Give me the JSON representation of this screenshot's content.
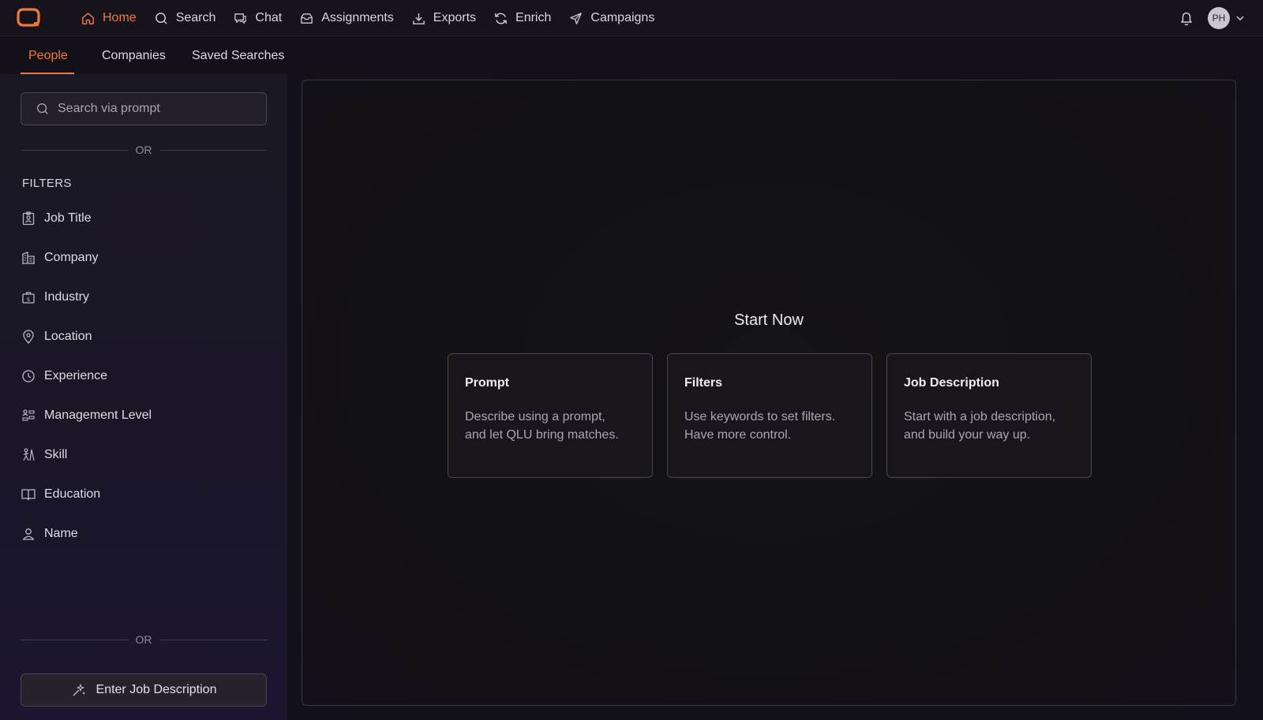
{
  "nav": {
    "items": [
      {
        "label": "Home",
        "icon": "home-icon",
        "active": true
      },
      {
        "label": "Search",
        "icon": "search-icon",
        "active": false
      },
      {
        "label": "Chat",
        "icon": "chat-icon",
        "active": false
      },
      {
        "label": "Assignments",
        "icon": "inbox-icon",
        "active": false
      },
      {
        "label": "Exports",
        "icon": "download-icon",
        "active": false
      },
      {
        "label": "Enrich",
        "icon": "refresh-icon",
        "active": false
      },
      {
        "label": "Campaigns",
        "icon": "send-icon",
        "active": false
      }
    ],
    "user_initials": "PH"
  },
  "subtabs": {
    "people": "People",
    "companies": "Companies",
    "saved_searches": "Saved Searches"
  },
  "sidebar": {
    "search_placeholder": "Search via prompt",
    "or_label": "OR",
    "filters_heading": "FILTERS",
    "filters": [
      {
        "label": "Job Title",
        "icon": "badge-icon"
      },
      {
        "label": "Company",
        "icon": "building-icon"
      },
      {
        "label": "Industry",
        "icon": "briefcase-dollar-icon"
      },
      {
        "label": "Location",
        "icon": "map-pin-icon"
      },
      {
        "label": "Experience",
        "icon": "clock-icon"
      },
      {
        "label": "Management Level",
        "icon": "hierarchy-icon"
      },
      {
        "label": "Skill",
        "icon": "skill-icon"
      },
      {
        "label": "Education",
        "icon": "book-icon"
      },
      {
        "label": "Name",
        "icon": "user-icon"
      }
    ],
    "job_description_button": "Enter Job Description"
  },
  "main": {
    "title": "Start Now",
    "cards": [
      {
        "title": "Prompt",
        "description_line1": "Describe using a prompt,",
        "description_line2": "and let QLU bring matches."
      },
      {
        "title": "Filters",
        "description_line1": "Use keywords to set filters.",
        "description_line2": "Have more control."
      },
      {
        "title": "Job Description",
        "description_line1": "Start with a job description,",
        "description_line2": "and build your way up."
      }
    ]
  },
  "colors": {
    "accent": "#f07a3c",
    "background": "#121018",
    "sidebar": "#1b1825"
  }
}
